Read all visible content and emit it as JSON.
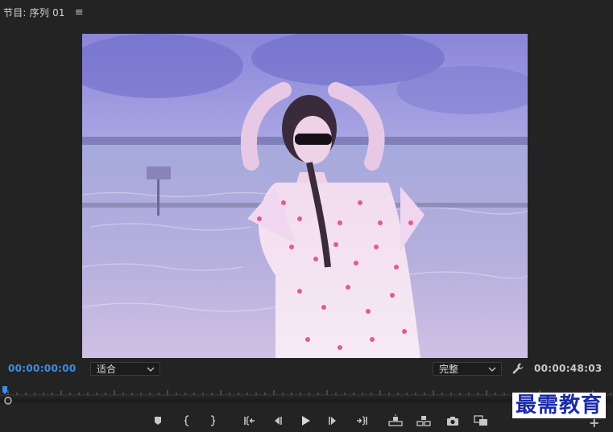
{
  "panel": {
    "title": "节目: 序列 01",
    "menu_glyph": "≡"
  },
  "timecodes": {
    "current": "00:00:00:00",
    "duration": "00:00:48:03"
  },
  "dropdowns": {
    "zoom_value": "适合",
    "quality_value": "完整"
  },
  "icons": {
    "wrench": "wrench-icon",
    "add_marker": "marker-icon",
    "mark_in": "mark-in-icon",
    "mark_out": "mark-out-icon",
    "go_to_in": "go-to-in-icon",
    "step_back": "step-back-icon",
    "play": "play-icon",
    "step_forward": "step-forward-icon",
    "go_to_out": "go-to-out-icon",
    "lift": "lift-icon",
    "extract": "extract-icon",
    "export_frame": "camera-icon",
    "comparison_view": "comparison-view-icon",
    "button_editor": "plus-icon"
  },
  "watermark": {
    "text": "最需教育"
  },
  "add_glyph": "+",
  "colors": {
    "background": "#232323",
    "accent_timecode": "#3d8ee6",
    "watermark": "#1b2aa8"
  }
}
